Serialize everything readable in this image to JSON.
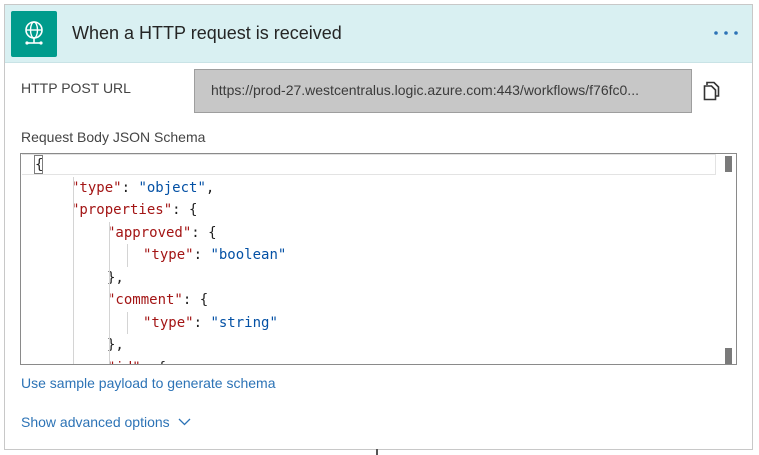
{
  "header": {
    "title": "When a HTTP request is received",
    "icon": "globe-network-icon",
    "more_icon": "ellipsis-icon",
    "colors": {
      "band": "#d9f0f2",
      "icon_bg": "#009b8c",
      "dots": "#2c73b6"
    }
  },
  "url": {
    "label": "HTTP POST URL",
    "value": "https://prod-27.westcentralus.logic.azure.com:443/workflows/f76fc0...",
    "copy_icon": "copy-icon"
  },
  "schema": {
    "label": "Request Body JSON Schema",
    "lines": [
      [
        {
          "t": "p",
          "v": "{"
        }
      ],
      [
        {
          "t": "k",
          "v": "\"type\""
        },
        {
          "t": "p",
          "v": ": "
        },
        {
          "t": "s",
          "v": "\"object\""
        },
        {
          "t": "p",
          "v": ","
        }
      ],
      [
        {
          "t": "k",
          "v": "\"properties\""
        },
        {
          "t": "p",
          "v": ": {"
        }
      ],
      [
        {
          "t": "k",
          "v": "\"approved\""
        },
        {
          "t": "p",
          "v": ": {"
        }
      ],
      [
        {
          "t": "k",
          "v": "\"type\""
        },
        {
          "t": "p",
          "v": ": "
        },
        {
          "t": "s",
          "v": "\"boolean\""
        }
      ],
      [
        {
          "t": "p",
          "v": "},"
        }
      ],
      [
        {
          "t": "k",
          "v": "\"comment\""
        },
        {
          "t": "p",
          "v": ": {"
        }
      ],
      [
        {
          "t": "k",
          "v": "\"type\""
        },
        {
          "t": "p",
          "v": ": "
        },
        {
          "t": "s",
          "v": "\"string\""
        }
      ],
      [
        {
          "t": "p",
          "v": "},"
        }
      ],
      [
        {
          "t": "k",
          "v": "\"id\""
        },
        {
          "t": "p",
          "v": ": {"
        }
      ]
    ],
    "indents": [
      0,
      1,
      1,
      2,
      3,
      2,
      2,
      3,
      2,
      2
    ]
  },
  "links": {
    "sample_payload": "Use sample payload to generate schema",
    "advanced": "Show advanced options",
    "advanced_icon": "chevron-down-icon"
  }
}
